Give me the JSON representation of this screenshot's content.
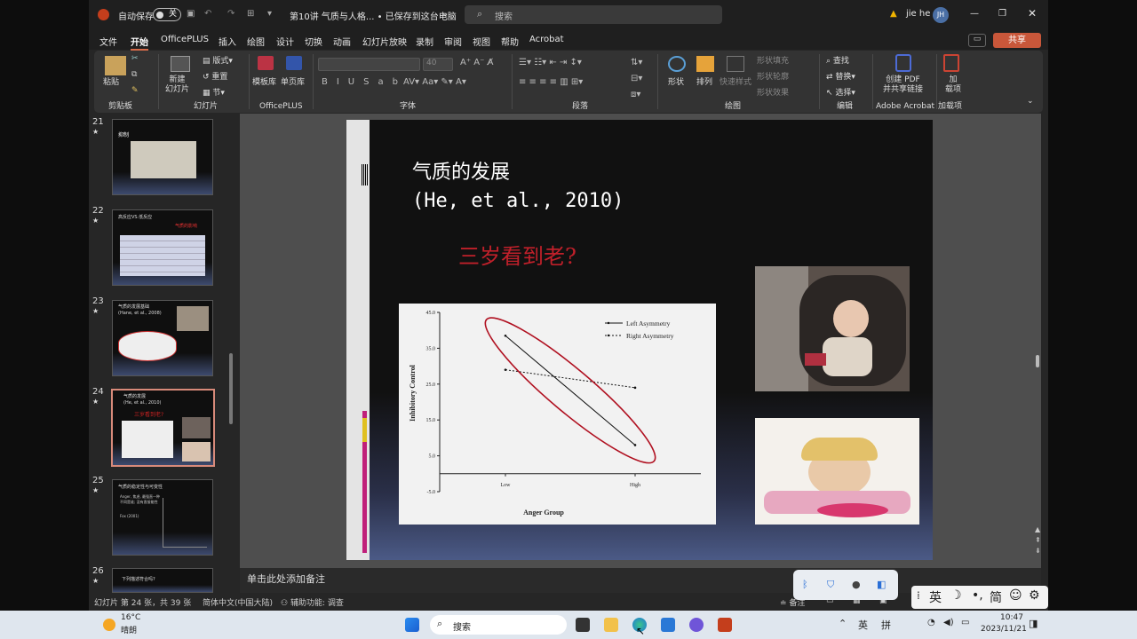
{
  "titlebar": {
    "autosave": "自动保存",
    "toggle": "关",
    "filename": "第10讲 气质与人格... • 已保存到这台电脑",
    "search_placeholder": "搜索",
    "user": "jie he",
    "user_initials": "JH"
  },
  "menu": [
    "文件",
    "开始",
    "OfficePLUS",
    "插入",
    "绘图",
    "设计",
    "切换",
    "动画",
    "幻灯片放映",
    "录制",
    "审阅",
    "视图",
    "帮助",
    "Acrobat"
  ],
  "share_label": "共享",
  "ribbon": {
    "paste": "粘贴",
    "clipboard": "剪贴板",
    "new_slide": "新建\n幻灯片",
    "layout": "版式",
    "reset": "重置",
    "section": "节",
    "slides_group": "幻灯片",
    "template": "模板库",
    "single_page": "单页库",
    "officeplus_group": "OfficePLUS",
    "font_size": "40",
    "font_group": "字体",
    "paragraph_group": "段落",
    "shapes": "形状",
    "arrange": "排列",
    "quick_styles": "快速样式",
    "shape_fill": "形状填充",
    "shape_outline": "形状轮廓",
    "shape_effects": "形状效果",
    "drawing_group": "绘图",
    "find": "查找",
    "replace": "替换",
    "select": "选择",
    "editing_group": "编辑",
    "create_pdf": "创建 PDF\n并共享链接",
    "acrobat_group": "Adobe Acrobat",
    "addins": "加\n载项",
    "addins_group": "加载项"
  },
  "thumbnails": [
    {
      "num": "21",
      "title": "抑制"
    },
    {
      "num": "22",
      "title": "高反应VS.低反应",
      "sub": "气质的影响"
    },
    {
      "num": "23",
      "title": "气质的发展基础\n(Hane, et al., 2008)"
    },
    {
      "num": "24",
      "title": "气质的发展\n(He, et al., 2010)",
      "sub": "三岁看到老?"
    },
    {
      "num": "25",
      "title": "气质的稳定性与可变性",
      "bullets": [
        "Anger, 焦虑, 最强直一种不同是谁; 没有直接能性",
        "Fox (2001)"
      ]
    },
    {
      "num": "26",
      "title": "下列描述符合吗?"
    }
  ],
  "slide": {
    "title_line1": "气质的发展",
    "title_line2": "(He, et al., 2010)",
    "subtitle": "三岁看到老?"
  },
  "chart_data": {
    "type": "line",
    "categories": [
      "Low",
      "High"
    ],
    "series": [
      {
        "name": "Left Asymmetry",
        "values": [
          38.5,
          8.0
        ],
        "style": "solid"
      },
      {
        "name": "Right Asymmetry",
        "values": [
          29.0,
          24.0
        ],
        "style": "dashed"
      }
    ],
    "xlabel": "Anger Group",
    "ylabel": "Inhibitory Control",
    "yticks": [
      45.0,
      35.0,
      25.0,
      15.0,
      5.0,
      -5.0
    ],
    "ylim": [
      -5,
      45
    ],
    "legend_position": "top-right",
    "annotation": "red ellipse around Left Asymmetry line"
  },
  "notes_placeholder": "单击此处添加备注",
  "status": {
    "slide_info": "幻灯片 第 24 张，共 39 张",
    "language": "简体中文(中国大陆)",
    "accessibility": "辅助功能: 调查",
    "notes": "备注"
  },
  "taskbar": {
    "weather_temp": "16°C",
    "weather_desc": "晴朗",
    "search": "搜索",
    "lang1": "英",
    "lang2": "拼",
    "time": "10:47",
    "date": "2023/11/21"
  },
  "ime": {
    "mode": "英",
    "symbols": "简"
  },
  "colors": {
    "accent": "#d66b4a",
    "subtitle_red": "#c0202a",
    "ellipse": "#b01020"
  }
}
